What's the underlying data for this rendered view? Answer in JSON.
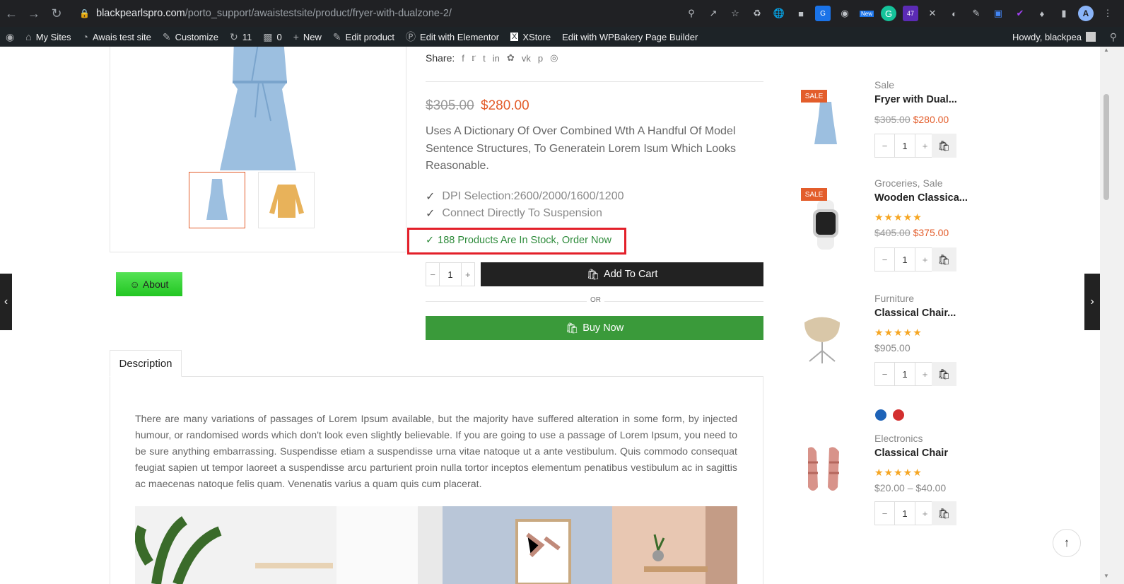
{
  "browser": {
    "url_host": "blackpearlspro.com",
    "url_path": "/porto_support/awaistestsite/product/fryer-with-dualzone-2/",
    "extensions": [
      "zoom-icon",
      "share-icon",
      "star-icon",
      "recycle-icon",
      "globe-icon",
      "car-icon",
      "translate-icon",
      "camera-icon",
      "new-badge-icon",
      "grammarly-icon",
      "puzzle-47-icon",
      "x-icon",
      "circle-icon",
      "pen-icon",
      "video-icon",
      "feather-icon",
      "extensions-icon",
      "sidebar-icon"
    ],
    "new_badge": "New",
    "badge_count": "47",
    "avatar_letter": "A"
  },
  "wp_bar": {
    "my_sites": "My Sites",
    "site_name": "Awais test site",
    "customize": "Customize",
    "updates_count": "11",
    "comments_count": "0",
    "new": "New",
    "edit_product": "Edit product",
    "edit_elementor": "Edit with Elementor",
    "xstore": "XStore",
    "edit_wpbakery": "Edit with WPBakery Page Builder",
    "howdy": "Howdy, blackpea"
  },
  "product": {
    "share_label": "Share:",
    "share_icons": [
      "f",
      "t",
      "t",
      "in",
      "✿",
      "vk",
      "p",
      "◎"
    ],
    "price_old": "$305.00",
    "price_new": "$280.00",
    "short_description": "Uses A Dictionary Of Over Combined Wth A Handful Of Model Sentence Structures, To Generatein Lorem Isum Which Looks Reasonable.",
    "features": [
      "DPI Selection:2600/2000/1600/1200",
      "Connect Directly To Suspension"
    ],
    "stock_text": "188 Products Are In Stock, Order Now",
    "qty": "1",
    "add_to_cart": "Add To Cart",
    "or": "OR",
    "buy_now": "Buy Now",
    "about_button": "About"
  },
  "tabs": {
    "description": "Description"
  },
  "long_description": "There are many variations of passages of Lorem Ipsum available, but the majority have suffered alteration in some form, by injected humour, or randomised words which don't look even slightly believable. If you are going to use a passage of Lorem Ipsum, you need to be sure anything embarrassing. Suspendisse etiam a suspendisse urna vitae natoque ut a ante vestibulum. Quis commodo consequat feugiat sapien ut tempor laoreet a suspendisse arcu parturient proin nulla tortor inceptos elementum penatibus vestibulum ac in sagittis ac maecenas natoque felis quam. Venenatis varius a quam quis cum placerat.",
  "sidebar": [
    {
      "sale": "SALE",
      "category": "Sale",
      "title": "Fryer with Dual...",
      "rating": "",
      "price_old": "$305.00",
      "price_new": "$280.00",
      "qty": "1"
    },
    {
      "sale": "SALE",
      "category": "Groceries, Sale",
      "title": "Wooden Classica...",
      "rating": "★★★★★",
      "price_old": "$405.00",
      "price_new": "$375.00",
      "qty": "1"
    },
    {
      "sale": "",
      "category": "Furniture",
      "title": "Classical Chair...",
      "rating": "★★★★★",
      "price": "$905.00",
      "qty": "1"
    },
    {
      "sale": "",
      "category": "Electronics",
      "title": "Classical Chair",
      "rating": "★★★★★",
      "price": "$20.00 – $40.00",
      "qty": "1"
    }
  ],
  "swatch_colors": [
    "#1e63b8",
    "#d32f2f"
  ],
  "colors": {
    "accent": "#e35d2b",
    "stock_green": "#2e8b3b",
    "buy_green": "#3a9a3a",
    "highlight_red": "#e3202a"
  }
}
